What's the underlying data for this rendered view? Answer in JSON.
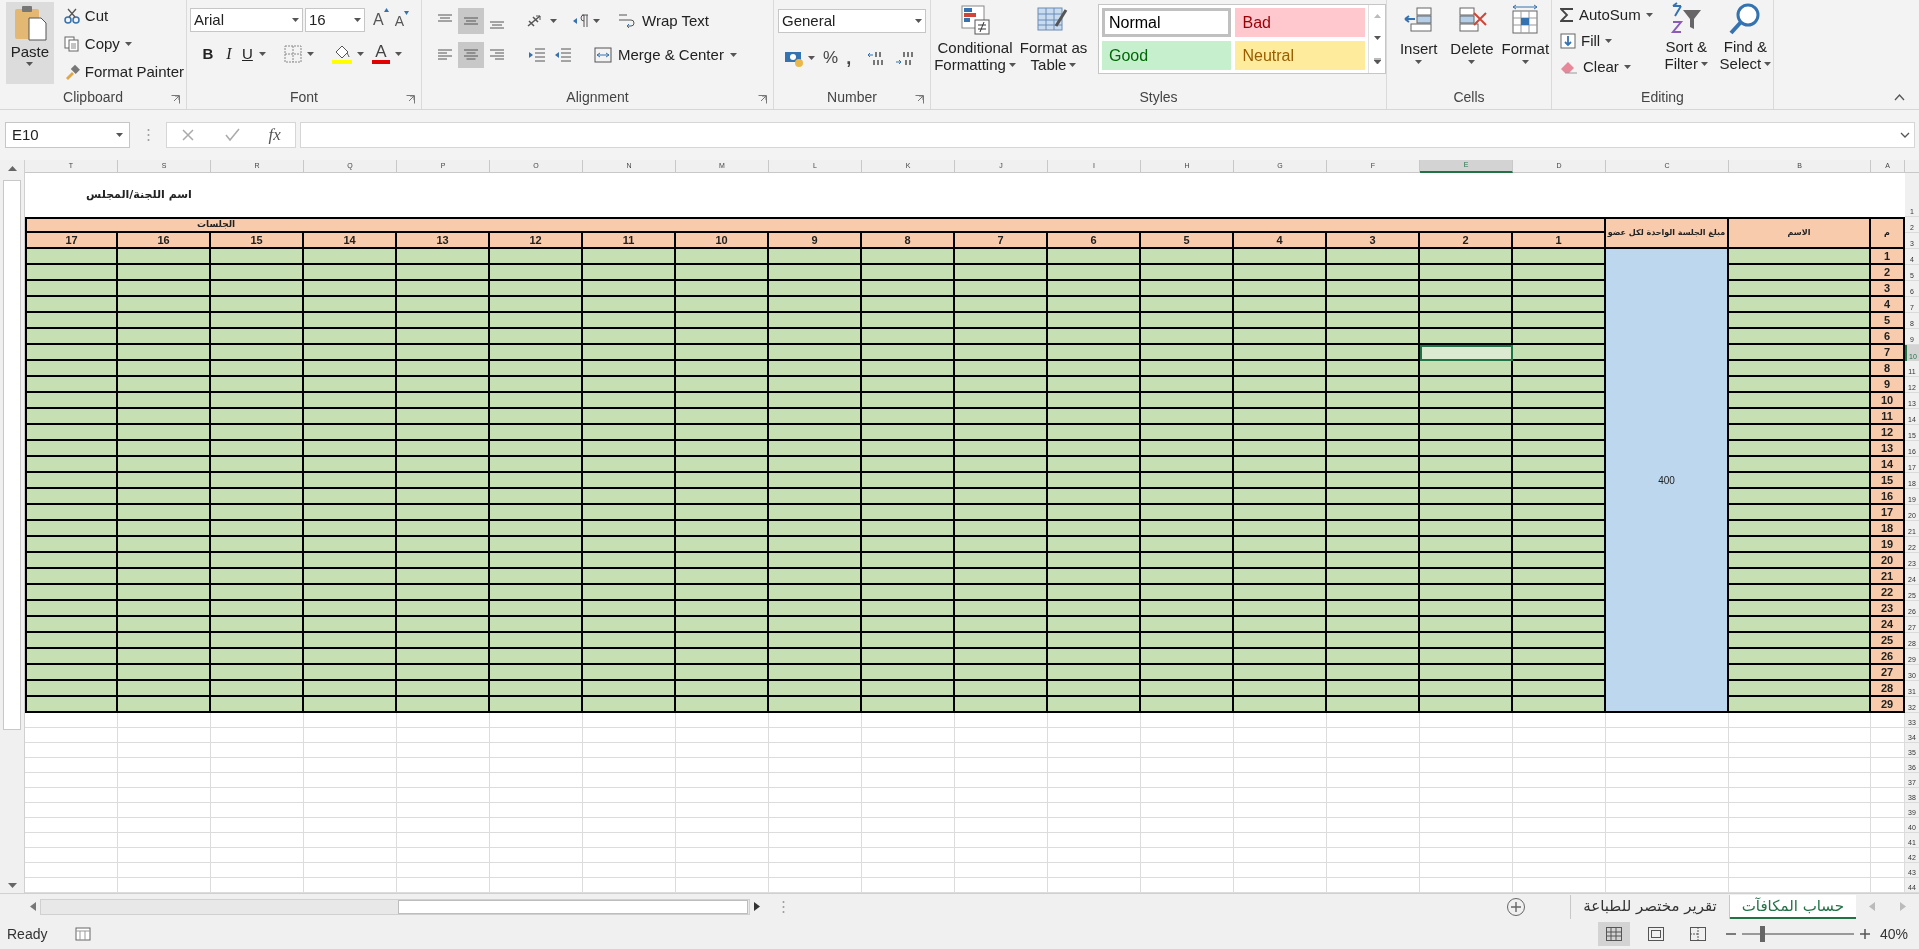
{
  "ribbon": {
    "clipboard": {
      "paste": "Paste",
      "cut": "Cut",
      "copy": "Copy",
      "format_painter": "Format Painter",
      "label": "Clipboard"
    },
    "font": {
      "font_name": "Arial",
      "font_size": "16",
      "grow": "A",
      "shrink": "A",
      "bold": "B",
      "italic": "I",
      "underline": "U",
      "font_color": "A",
      "label": "Font"
    },
    "alignment": {
      "vertical_align": [
        {
          "selected": false
        },
        {
          "selected": true
        },
        {
          "selected": false
        }
      ],
      "horizontal_align": [
        {
          "selected": false
        },
        {
          "selected": true
        },
        {
          "selected": false
        }
      ],
      "wrap_text": "Wrap Text",
      "merge_center": "Merge & Center",
      "label": "Alignment"
    },
    "number": {
      "format": "General",
      "percent": "%",
      "comma": ",",
      "label": "Number"
    },
    "styles": {
      "conditional_formatting": [
        "Conditional",
        "Formatting"
      ],
      "format_as_table": [
        "Format as",
        "Table"
      ],
      "cell_styles": [
        {
          "label": "Normal",
          "color": "#ffffff",
          "selected": true
        },
        {
          "label": "Bad",
          "color": "#ffc7ce",
          "selected": false
        },
        {
          "label": "Good",
          "color": "#c6efce",
          "selected": false
        },
        {
          "label": "Neutral",
          "color": "#ffeb9c",
          "selected": false
        }
      ],
      "label": "Styles"
    },
    "cells": {
      "buttons": [
        {
          "kind": "insert",
          "label": "Insert"
        },
        {
          "kind": "delete",
          "label": "Delete"
        },
        {
          "kind": "format",
          "label": "Format"
        }
      ],
      "label": "Cells"
    },
    "editing": {
      "autosum": "AutoSum",
      "fill": "Fill",
      "clear": "Clear",
      "sort_filter": [
        "Sort &",
        "Filter"
      ],
      "find_select": [
        "Find &",
        "Select"
      ],
      "label": "Editing"
    }
  },
  "formula_bar": {
    "name_box": "E10",
    "fx": "fx"
  },
  "sheet": {
    "column_headers": [
      {
        "label": "T",
        "selected": false
      },
      {
        "label": "S",
        "selected": false
      },
      {
        "label": "R",
        "selected": false
      },
      {
        "label": "Q",
        "selected": false
      },
      {
        "label": "P",
        "selected": false
      },
      {
        "label": "O",
        "selected": false
      },
      {
        "label": "N",
        "selected": false
      },
      {
        "label": "M",
        "selected": false
      },
      {
        "label": "L",
        "selected": false
      },
      {
        "label": "K",
        "selected": false
      },
      {
        "label": "J",
        "selected": false
      },
      {
        "label": "I",
        "selected": false
      },
      {
        "label": "H",
        "selected": false
      },
      {
        "label": "G",
        "selected": false
      },
      {
        "label": "F",
        "selected": false
      },
      {
        "label": "E",
        "selected": true
      },
      {
        "label": "D",
        "selected": false
      },
      {
        "label": "C",
        "selected": false
      },
      {
        "label": "B",
        "selected": false
      },
      {
        "label": "A",
        "selected": false
      }
    ],
    "row_numbers": [
      {
        "label": "1",
        "selected": false
      },
      {
        "label": "2",
        "selected": false
      },
      {
        "label": "3",
        "selected": false
      },
      {
        "label": "4",
        "selected": false
      },
      {
        "label": "5",
        "selected": false
      },
      {
        "label": "6",
        "selected": false
      },
      {
        "label": "7",
        "selected": false
      },
      {
        "label": "8",
        "selected": false
      },
      {
        "label": "9",
        "selected": false
      },
      {
        "label": "10",
        "selected": true
      },
      {
        "label": "11",
        "selected": false
      },
      {
        "label": "12",
        "selected": false
      },
      {
        "label": "13",
        "selected": false
      },
      {
        "label": "14",
        "selected": false
      },
      {
        "label": "15",
        "selected": false
      },
      {
        "label": "16",
        "selected": false
      },
      {
        "label": "17",
        "selected": false
      },
      {
        "label": "18",
        "selected": false
      },
      {
        "label": "19",
        "selected": false
      },
      {
        "label": "20",
        "selected": false
      },
      {
        "label": "21",
        "selected": false
      },
      {
        "label": "22",
        "selected": false
      },
      {
        "label": "23",
        "selected": false
      },
      {
        "label": "24",
        "selected": false
      },
      {
        "label": "25",
        "selected": false
      },
      {
        "label": "26",
        "selected": false
      },
      {
        "label": "27",
        "selected": false
      },
      {
        "label": "28",
        "selected": false
      },
      {
        "label": "29",
        "selected": false
      },
      {
        "label": "30",
        "selected": false
      },
      {
        "label": "31",
        "selected": false
      },
      {
        "label": "32",
        "selected": false
      },
      {
        "label": "33",
        "selected": false
      },
      {
        "label": "34",
        "selected": false
      },
      {
        "label": "35",
        "selected": false
      },
      {
        "label": "36",
        "selected": false
      },
      {
        "label": "37",
        "selected": false
      },
      {
        "label": "38",
        "selected": false
      },
      {
        "label": "39",
        "selected": false
      },
      {
        "label": "40",
        "selected": false
      },
      {
        "label": "41",
        "selected": false
      },
      {
        "label": "42",
        "selected": false
      },
      {
        "label": "43",
        "selected": false
      },
      {
        "label": "44",
        "selected": false
      }
    ],
    "title": "اسم اللجنة/المجلس",
    "sessions_header": "الجلسات",
    "session_numbers": [
      "17",
      "16",
      "15",
      "14",
      "13",
      "12",
      "11",
      "10",
      "9",
      "8",
      "7",
      "6",
      "5",
      "4",
      "3",
      "2",
      "1"
    ],
    "amount_header": "مبلغ الجلسة الواحدة لكل عضو",
    "name_header": "الاسم",
    "index_header": "م",
    "serials": [
      "1",
      "2",
      "3",
      "4",
      "5",
      "6",
      "7",
      "8",
      "9",
      "10",
      "11",
      "12",
      "13",
      "14",
      "15",
      "16",
      "17",
      "18",
      "19",
      "20",
      "21",
      "22",
      "23",
      "24",
      "25",
      "26",
      "27",
      "28",
      "29"
    ],
    "amount_value": "400"
  },
  "sheet_tabs": [
    {
      "label": "حساب المكافآت",
      "selected": true
    },
    {
      "label": "تقرير مختصر للطباعة",
      "selected": false
    }
  ],
  "status_bar": {
    "ready": "Ready",
    "zoom": "40%",
    "zoom_slider": {
      "level": 0.18
    }
  }
}
